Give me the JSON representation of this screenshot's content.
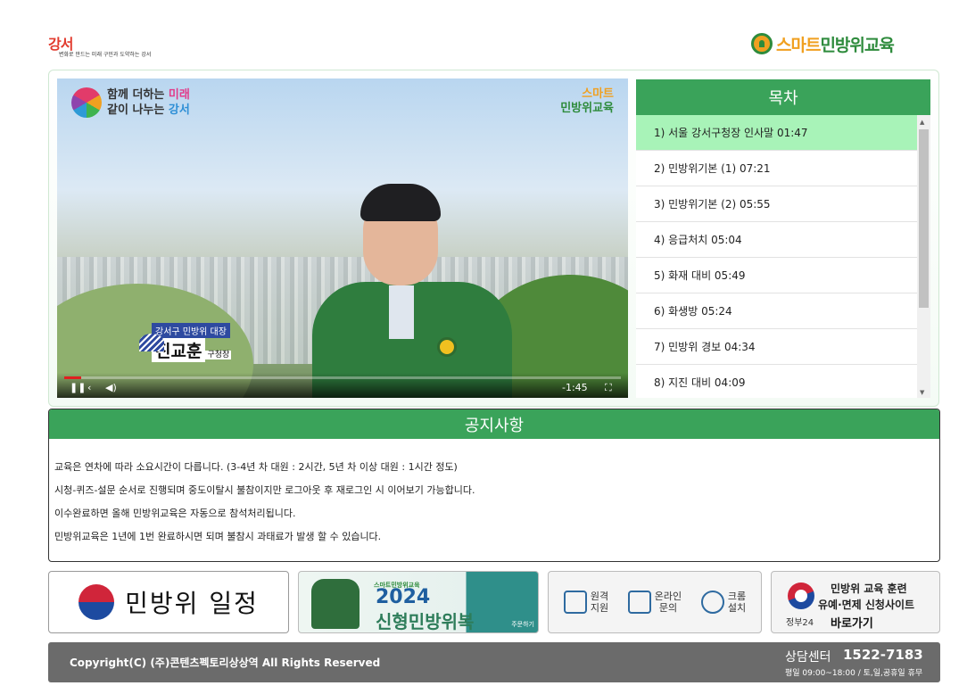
{
  "header": {
    "left_logo_text": "강서",
    "left_logo_tagline": "변화로 만드는 미래 구민과 도약하는 강서",
    "right_logo_part1": "스마트",
    "right_logo_part2": "민방위교육"
  },
  "video": {
    "overlay_tl_line1_a": "함께 더하는 ",
    "overlay_tl_line1_b": "미래",
    "overlay_tl_line2_a": "같이 나누는 ",
    "overlay_tl_line2_b": "강서",
    "overlay_tr_line1": "스마트",
    "overlay_tr_line2": "민방위교육",
    "speaker_role": "강서구 민방위 대장",
    "speaker_name": "진교훈",
    "speaker_title": "구청장",
    "time_remaining": "-1:45",
    "progress": 0.03
  },
  "toc": {
    "title": "목차",
    "items": [
      "1) 서울 강서구청장 인사말 01:47",
      "2) 민방위기본 (1) 07:21",
      "3) 민방위기본 (2) 05:55",
      "4) 응급처치 05:04",
      "5) 화재 대비 05:49",
      "6) 화생방 05:24",
      "7) 민방위 경보 04:34",
      "8) 지진 대비 04:09"
    ],
    "active_index": 0
  },
  "notice": {
    "title": "공지사항",
    "lines": [
      "교육은 연차에 따라 소요시간이 다릅니다. (3-4년 차 대원 : 2시간, 5년 차 이상 대원 : 1시간 정도)",
      "시청-퀴즈-설문 순서로 진행되며 중도이탈시 불참이지만 로그아웃 후 재로그인 시 이어보기 가능합니다.",
      "이수완료하면 올해 민방위교육은 자동으로 참석처리됩니다.",
      "민방위교육은 1년에 1번 완료하시면 되며 불참시 과태료가 발생 할 수 있습니다."
    ]
  },
  "banners": {
    "schedule_label": "민방위 일정",
    "uniform_small": "스마트민방위교육",
    "uniform_year": "2024",
    "uniform_name": "신형민방위복",
    "uniform_order": "주문하기",
    "support": [
      {
        "label": "원격\n지원",
        "icon": "remote-support-icon"
      },
      {
        "label": "온라인\n문의",
        "icon": "online-inquiry-icon"
      },
      {
        "label": "크롬\n설치",
        "icon": "chrome-icon"
      }
    ],
    "gov_line1": "민방위 교육 훈련",
    "gov_line2": "유예·면제 신청사이트",
    "gov_line3": "바로가기",
    "gov_brand": "정부24"
  },
  "footer": {
    "copyright": "Copyright(C) (주)콘텐츠펙토리상상역 All Rights Reserved",
    "cs_label": "상담센터",
    "cs_phone": "1522-7183",
    "hours": "평일 09:00~18:00 / 토,일,공휴일 휴무"
  },
  "colors": {
    "primary_green": "#3aa35a",
    "active_item": "#a8f3b8",
    "footer_gray": "#6b6b6b",
    "brand_orange": "#f0a020"
  }
}
